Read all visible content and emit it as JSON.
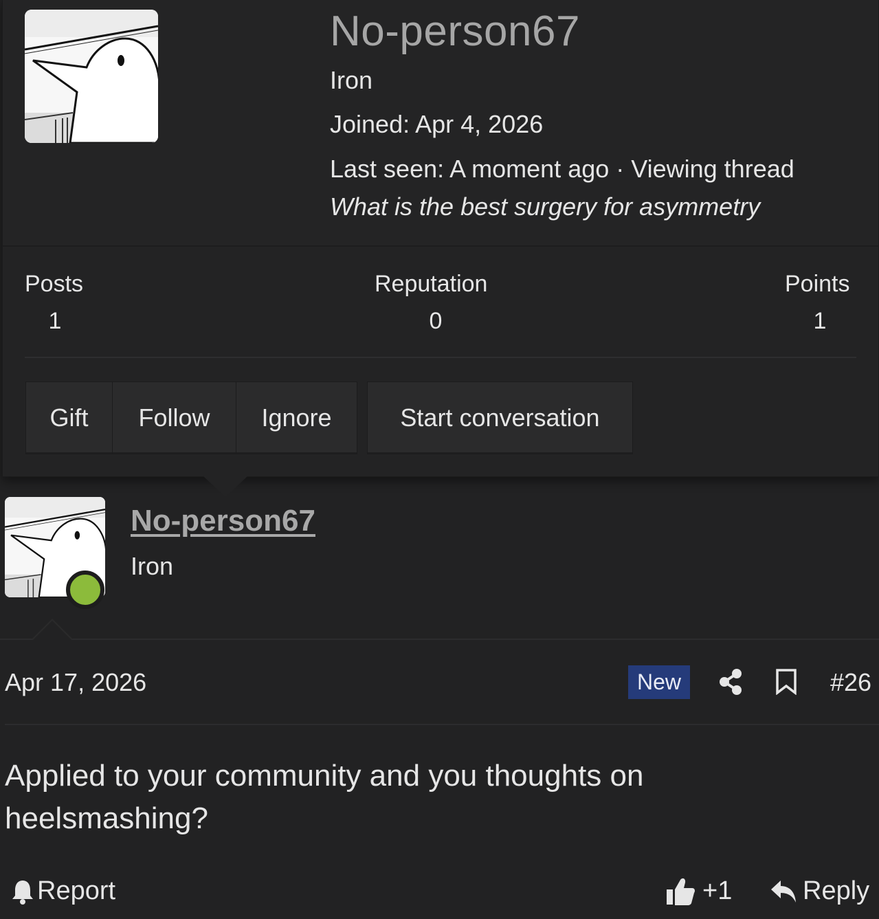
{
  "card": {
    "username": "No-person67",
    "user_title": "Iron",
    "joined": "Joined: Apr 4, 2026",
    "last_seen": "Last seen: A moment ago · Viewing thread",
    "activity": "What is the best surgery for asymmetry",
    "stats": [
      {
        "label": "Posts",
        "value": "1"
      },
      {
        "label": "Reputation",
        "value": "0"
      },
      {
        "label": "Points",
        "value": "1"
      }
    ],
    "buttons": [
      "Gift",
      "Follow",
      "Ignore",
      "Start conversation"
    ]
  },
  "post": {
    "username": "No-person67",
    "user_title": "Iron",
    "online": true,
    "date": "Apr 17, 2026",
    "badge": "New",
    "number": "#26",
    "body_lines": [
      "Applied to your community and you thoughts on",
      "heelsmashing?"
    ],
    "actions": {
      "report": "Report",
      "reaction_count": "+1",
      "reply": "Reply"
    }
  },
  "colors": {
    "background": "#222223",
    "badge_new": "#253b7a",
    "online_status": "#8cbb3b",
    "username_link": "#a8a8a8"
  },
  "icons": {
    "share": "share-icon",
    "bookmark": "bookmark-icon",
    "report": "bell-icon",
    "like": "thumbs-up-icon",
    "reply": "reply-arrow-icon"
  }
}
